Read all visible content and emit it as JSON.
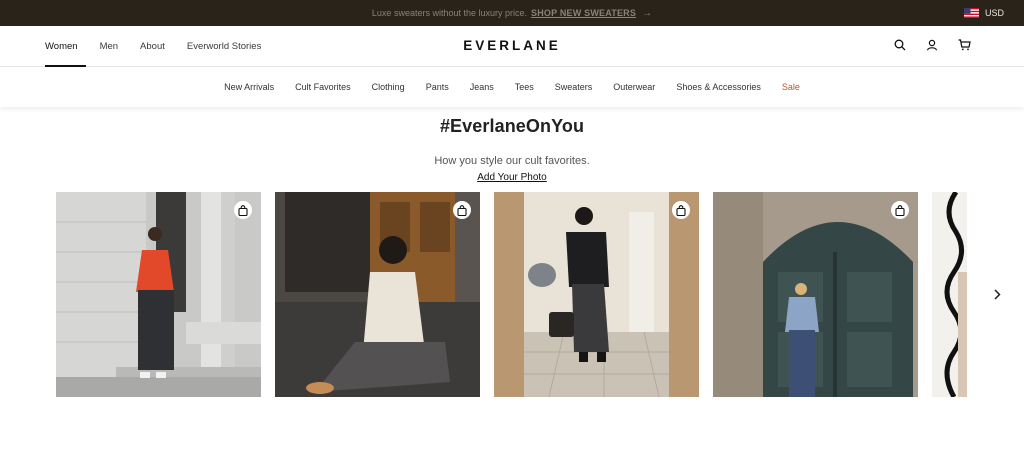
{
  "promo": {
    "text": "Luxe sweaters without the luxury price.",
    "link": "SHOP NEW SWEATERS",
    "arrow": "→",
    "currency": "USD"
  },
  "header": {
    "primary_nav": [
      "Women",
      "Men",
      "About",
      "Everworld Stories"
    ],
    "logo": "EVERLANE",
    "icons": [
      "search-icon",
      "account-icon",
      "cart-icon"
    ]
  },
  "categories": [
    "New Arrivals",
    "Cult Favorites",
    "Clothing",
    "Pants",
    "Jeans",
    "Tees",
    "Sweaters",
    "Outerwear",
    "Shoes & Accessories",
    "Sale"
  ],
  "hero": {
    "title": "#EverlaneOnYou",
    "subtitle": "How you style our cult favorites.",
    "cta": "Add Your Photo"
  },
  "gallery": {
    "icons": [
      "shopping-bag-icon",
      "chevron-right-icon"
    ]
  },
  "colors": {
    "promo_bg": "#2a2319",
    "sale": "#b5562f",
    "text": "#262626"
  }
}
